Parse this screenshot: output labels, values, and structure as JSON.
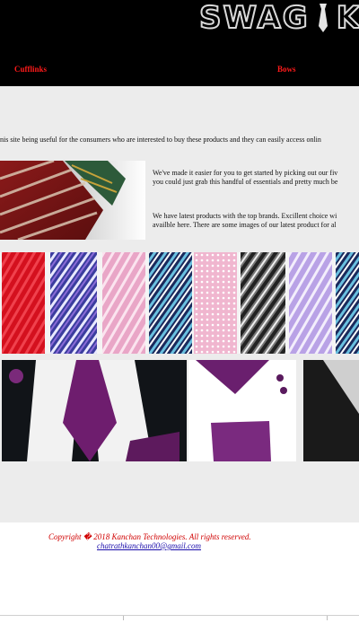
{
  "header": {
    "logo_part1": "SWAG",
    "logo_part2": "KNO",
    "nav": [
      "Cufflinks",
      "Bows"
    ]
  },
  "main": {
    "intro": "nis site being useful for the consumers who are interested to buy these products and they can easily access onlin",
    "para1_line1": "We've made it easier for you to get started by picking out our fiv",
    "para1_line2": "you could just grab this handful of essentials and pretty much be",
    "para2_line1": "We have latest products with the top brands. Excillent choice wi",
    "para2_line2": "availble here. There are some images of our latest product for al"
  },
  "footer": {
    "copyright": "Copyright � 2018 Kanchan Technologies. All rights reserved.",
    "email": "chatrathkanchan00@gmail.com"
  },
  "colors": {
    "header_bg": "#000000",
    "nav_text": "#ff1a1a",
    "main_bg": "#ececec",
    "copyright_text": "#d00000",
    "link": "#1a0dab"
  }
}
